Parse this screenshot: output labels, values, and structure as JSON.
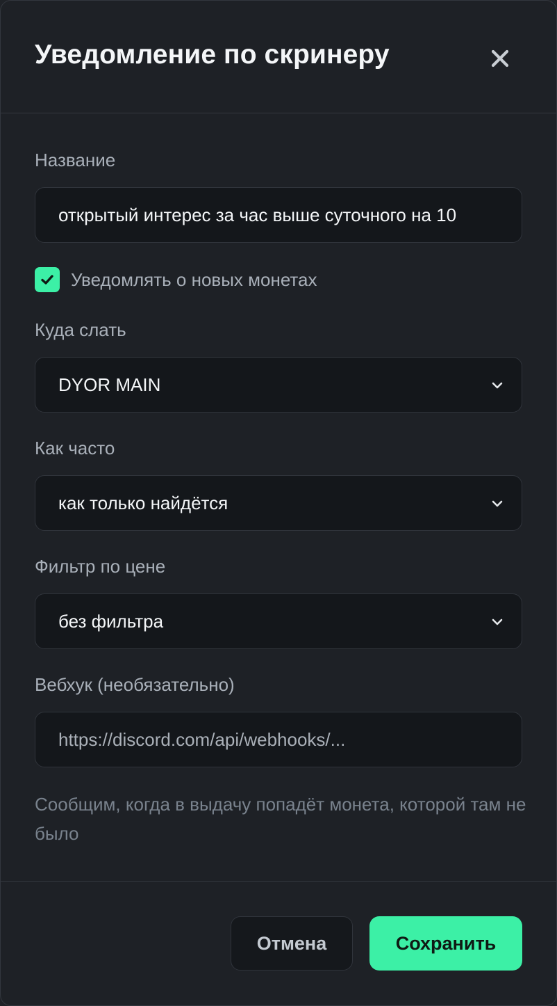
{
  "dialog": {
    "title": "Уведомление по скринеру",
    "close_icon": "close-icon"
  },
  "form": {
    "name_label": "Название",
    "name_value": "открытый интерес за час выше суточного на 10",
    "notify_new_coins": {
      "label": "Уведомлять о новых монетах",
      "checked": true
    },
    "destination": {
      "label": "Куда слать",
      "selected": "DYOR MAIN"
    },
    "frequency": {
      "label": "Как часто",
      "selected": "как только найдётся"
    },
    "price_filter": {
      "label": "Фильтр по цене",
      "selected": "без фильтра"
    },
    "webhook": {
      "label": "Вебхук (необязательно)",
      "placeholder": "https://discord.com/api/webhooks/..."
    },
    "hint": "Сообщим, когда в выдачу попадёт монета, которой там не было"
  },
  "footer": {
    "cancel_label": "Отмена",
    "save_label": "Сохранить"
  },
  "colors": {
    "accent": "#3cf0a6",
    "background": "#1e2126",
    "field_background": "#14171b"
  }
}
